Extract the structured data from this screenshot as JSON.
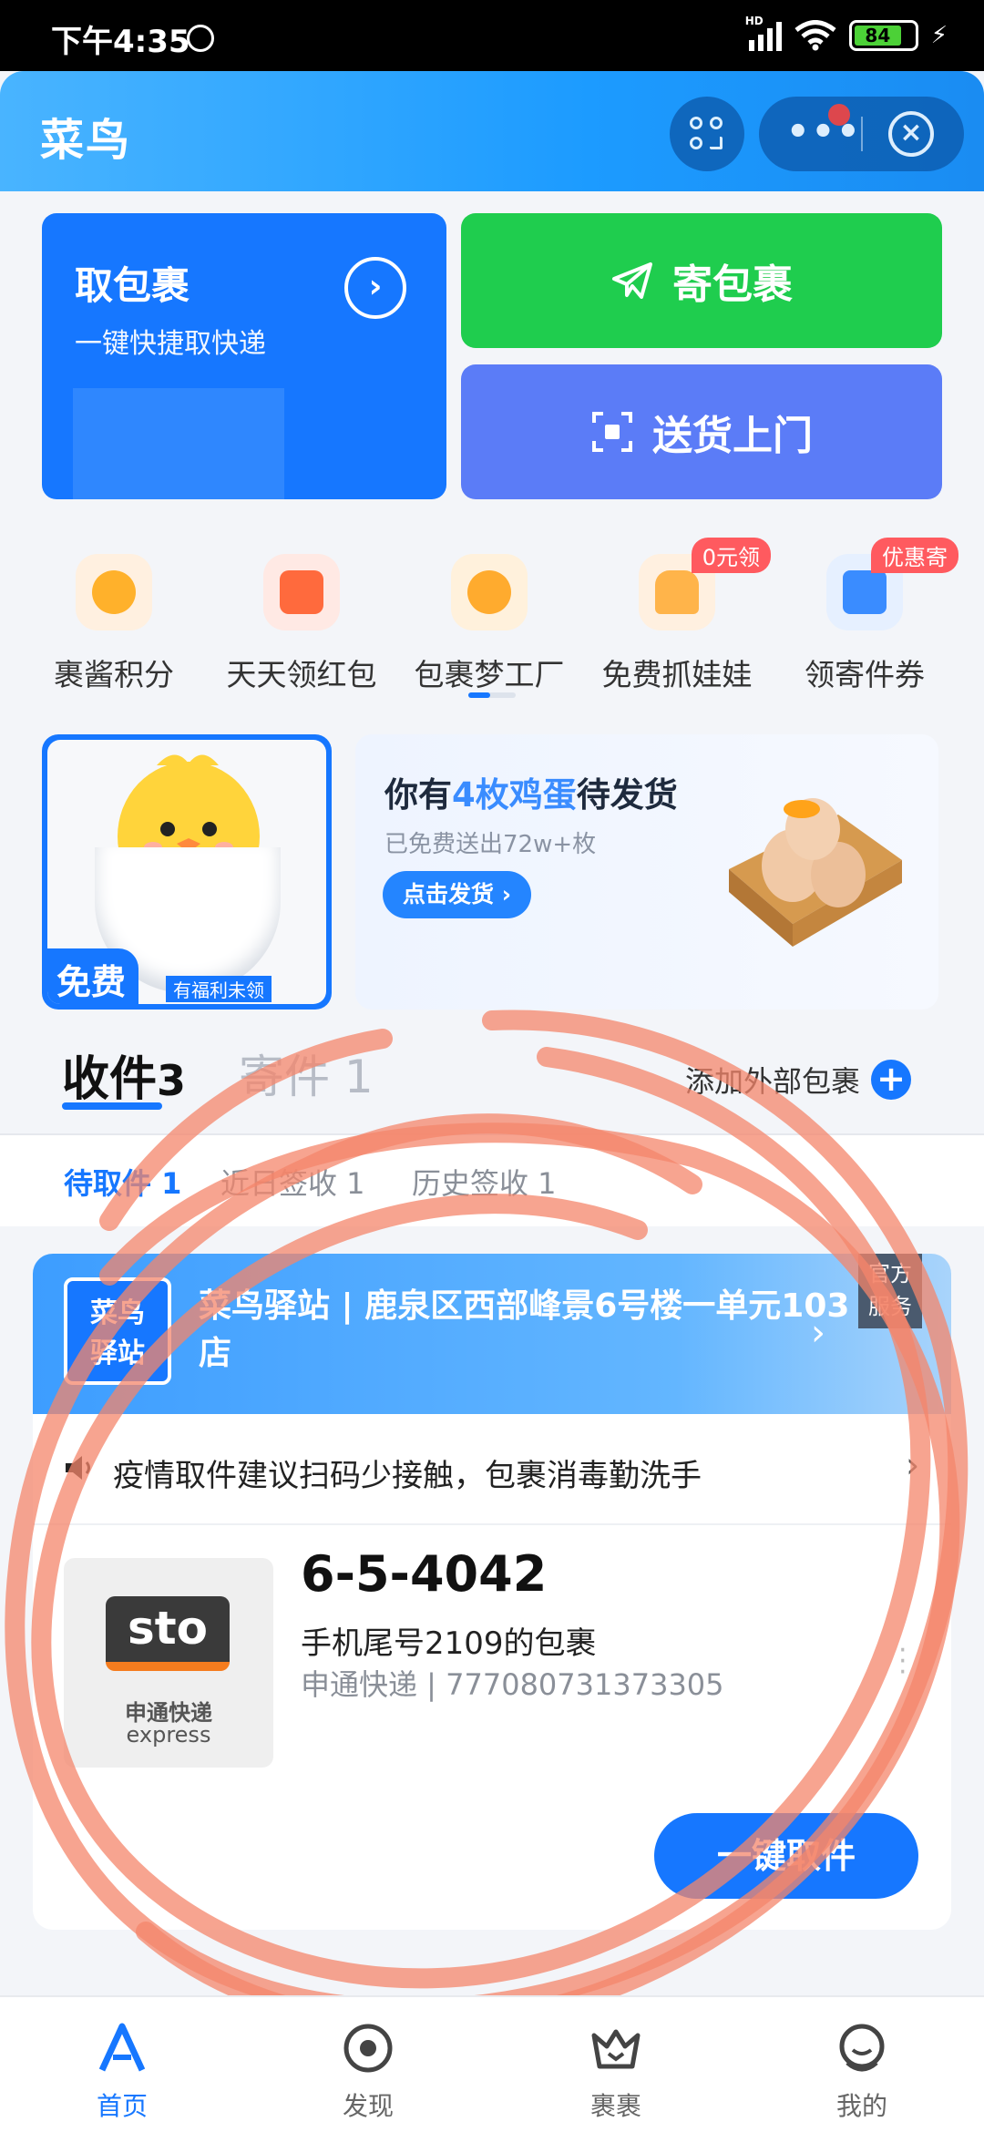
{
  "status_bar": {
    "time": "下午4:35",
    "network": "HD",
    "battery": "84"
  },
  "header": {
    "title": "菜鸟"
  },
  "cards": {
    "pickup_title": "取包裹",
    "pickup_subtitle": "一键快捷取快递",
    "send_label": "寄包裹",
    "deliver_label": "送货上门"
  },
  "shortcuts": [
    {
      "label": "裹酱积分",
      "badge": ""
    },
    {
      "label": "天天领红包",
      "badge": ""
    },
    {
      "label": "包裹梦工厂",
      "badge": ""
    },
    {
      "label": "免费抓娃娃",
      "badge": "0元领"
    },
    {
      "label": "领寄件券",
      "badge": "优惠寄"
    }
  ],
  "promo": {
    "free_label": "免费",
    "unclaimed_label": "有福利未领",
    "headline_pre": "你有",
    "headline_highlight": "4枚鸡蛋",
    "headline_post": "待发货",
    "subtitle": "已免费送出72w+枚",
    "button": "点击发货"
  },
  "tabs": {
    "receive_label": "收件",
    "receive_count": "3",
    "send_label": "寄件",
    "send_count": "1",
    "add_external": "添加外部包裹"
  },
  "subtabs": [
    {
      "label": "待取件 1",
      "active": true
    },
    {
      "label": "近日签收 1",
      "active": false
    },
    {
      "label": "历史签收 1",
      "active": false
    }
  ],
  "package": {
    "station_logo_line1": "菜鸟",
    "station_logo_line2": "驿站",
    "station_name": "菜鸟驿站 | 鹿泉区西部峰景6号楼一单元103店",
    "official_line1": "官方",
    "official_line2": "服务",
    "notice": "疫情取件建议扫码少接触，包裹消毒勤洗手",
    "courier_logo": "sto",
    "courier_cn": "申通快递",
    "courier_en": "express",
    "pickup_code": "6-5-4042",
    "phone_label": "手机尾号2109的包裹",
    "tracking": "申通快递 | 777080731373305",
    "pickup_button": "一键取件"
  },
  "bottom_nav": [
    {
      "label": "首页",
      "icon": "home-icon",
      "active": true
    },
    {
      "label": "发现",
      "icon": "discover-icon",
      "active": false
    },
    {
      "label": "裹裹",
      "icon": "crown-icon",
      "active": false
    },
    {
      "label": "我的",
      "icon": "profile-icon",
      "active": false
    }
  ],
  "colors": {
    "brand": "#1677ff",
    "send_green": "#1fcd4e",
    "deliver_purple": "#5b7cf7",
    "scribble": "#f4866b"
  }
}
